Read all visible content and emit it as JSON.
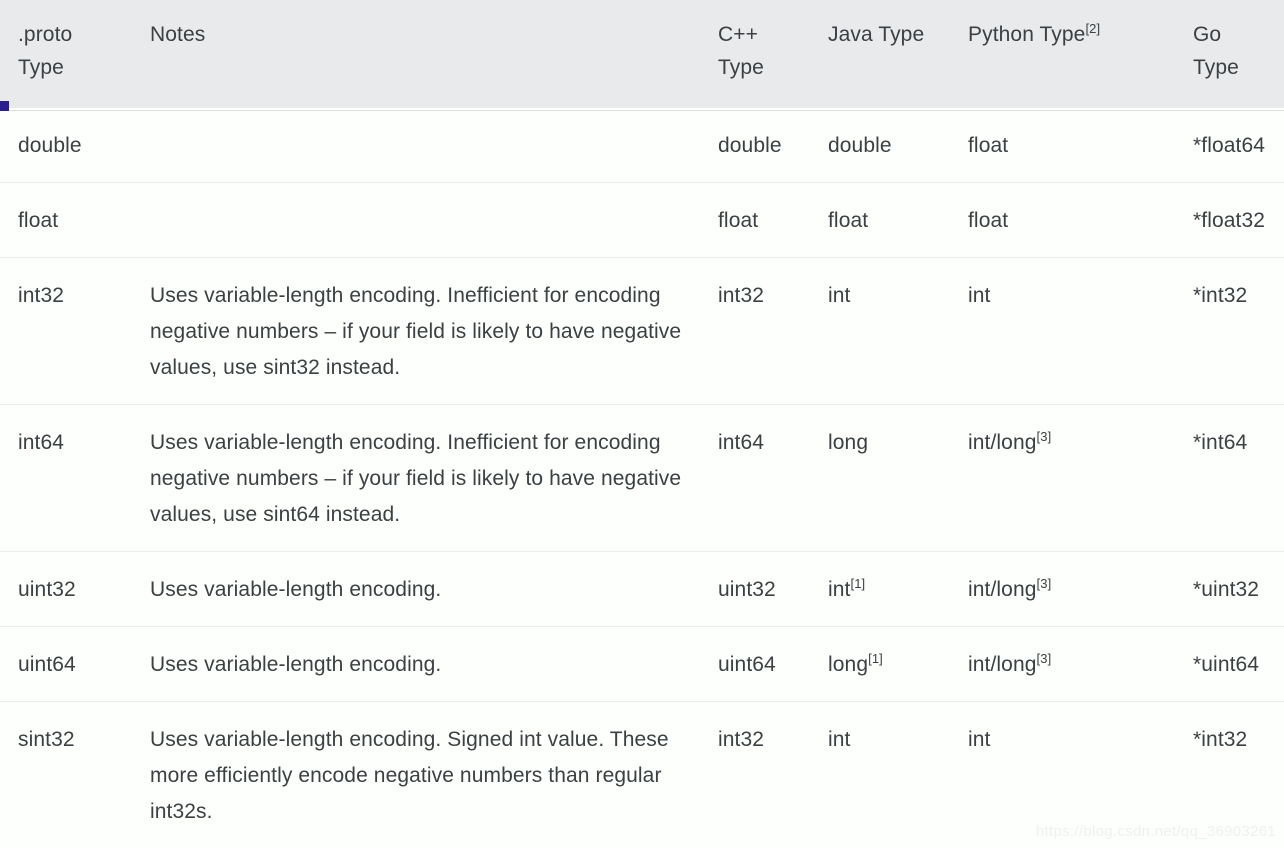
{
  "table": {
    "columns": [
      {
        "key": "proto",
        "label_line1": ".proto",
        "label_line2": "Type",
        "label": ".proto Type"
      },
      {
        "key": "notes",
        "label_line1": "Notes",
        "label_line2": "",
        "label": "Notes"
      },
      {
        "key": "cpp",
        "label_line1": "C++",
        "label_line2": "Type",
        "label": "C++ Type"
      },
      {
        "key": "java",
        "label_line1": "Java Type",
        "label_line2": "",
        "label": "Java Type"
      },
      {
        "key": "python",
        "label_line1": "Python Type",
        "label_line2": "",
        "label": "Python Type",
        "footnote": "[2]"
      },
      {
        "key": "go",
        "label_line1": "Go",
        "label_line2": "Type",
        "label": "Go Type"
      }
    ],
    "rows": [
      {
        "proto": "double",
        "notes": "",
        "cpp": "double",
        "java": "double",
        "java_footnote": "",
        "python": "float",
        "python_footnote": "",
        "go": "*float64"
      },
      {
        "proto": "float",
        "notes": "",
        "cpp": "float",
        "java": "float",
        "java_footnote": "",
        "python": "float",
        "python_footnote": "",
        "go": "*float32"
      },
      {
        "proto": "int32",
        "notes": "Uses variable-length encoding. Inefficient for encoding negative numbers – if your field is likely to have negative values, use sint32 instead.",
        "cpp": "int32",
        "java": "int",
        "java_footnote": "",
        "python": "int",
        "python_footnote": "",
        "go": "*int32"
      },
      {
        "proto": "int64",
        "notes": "Uses variable-length encoding. Inefficient for encoding negative numbers – if your field is likely to have negative values, use sint64 instead.",
        "cpp": "int64",
        "java": "long",
        "java_footnote": "",
        "python": "int/long",
        "python_footnote": "[3]",
        "go": "*int64"
      },
      {
        "proto": "uint32",
        "notes": "Uses variable-length encoding.",
        "cpp": "uint32",
        "java": "int",
        "java_footnote": "[1]",
        "python": "int/long",
        "python_footnote": "[3]",
        "go": "*uint32"
      },
      {
        "proto": "uint64",
        "notes": "Uses variable-length encoding.",
        "cpp": "uint64",
        "java": "long",
        "java_footnote": "[1]",
        "python": "int/long",
        "python_footnote": "[3]",
        "go": "*uint64"
      },
      {
        "proto": "sint32",
        "notes": "Uses variable-length encoding. Signed int value. These more efficiently encode negative numbers than regular int32s.",
        "cpp": "int32",
        "java": "int",
        "java_footnote": "",
        "python": "int",
        "python_footnote": "",
        "go": "*int32"
      }
    ]
  },
  "watermark": {
    "text": "https://blog.csdn.net/qq_36903261"
  },
  "colors": {
    "header_background": "#e8eaec",
    "body_background": "#fdfffc",
    "text": "#3c4043",
    "row_divider": "#ececec",
    "accent_tick": "#2a1f8f",
    "watermark": "#f0f0ee"
  }
}
